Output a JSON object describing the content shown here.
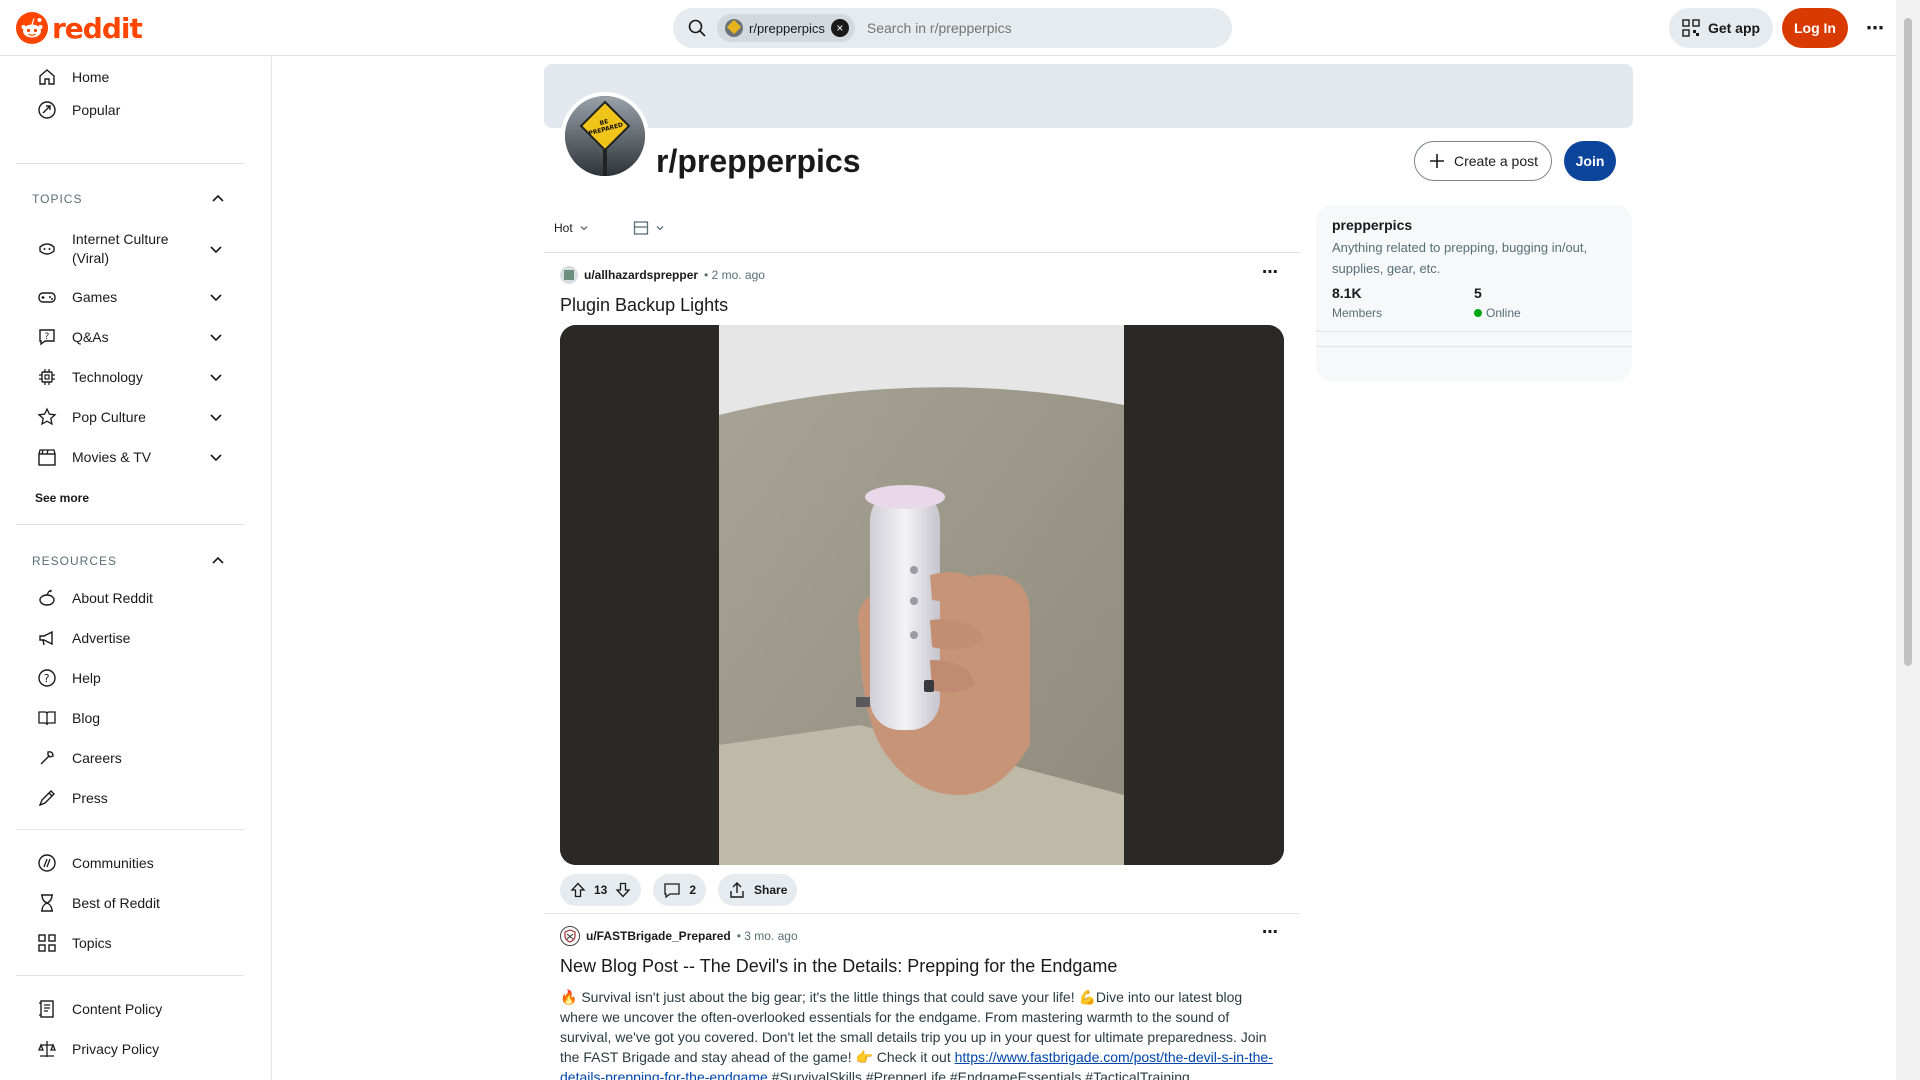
{
  "header": {
    "logo_text": "reddit",
    "search_chip": "r/prepperpics",
    "search_placeholder": "Search in r/prepperpics",
    "get_app": "Get app",
    "login": "Log In"
  },
  "sidebar": {
    "top_items": [
      {
        "label": "Home",
        "icon": "home-icon"
      },
      {
        "label": "Popular",
        "icon": "popular-icon"
      }
    ],
    "topics_title": "TOPICS",
    "topics": [
      {
        "label": "Internet Culture (Viral)",
        "line1": "Internet Culture",
        "line2": "(Viral)",
        "icon": "internet-culture-icon"
      },
      {
        "label": "Games",
        "icon": "games-icon"
      },
      {
        "label": "Q&As",
        "icon": "qa-icon"
      },
      {
        "label": "Technology",
        "icon": "technology-icon"
      },
      {
        "label": "Pop Culture",
        "icon": "pop-culture-icon"
      },
      {
        "label": "Movies & TV",
        "icon": "movies-tv-icon"
      }
    ],
    "see_more": "See more",
    "resources_title": "RESOURCES",
    "resources": [
      {
        "label": "About Reddit",
        "icon": "about-reddit-icon"
      },
      {
        "label": "Advertise",
        "icon": "advertise-icon"
      },
      {
        "label": "Help",
        "icon": "help-icon"
      },
      {
        "label": "Blog",
        "icon": "blog-icon"
      },
      {
        "label": "Careers",
        "icon": "careers-icon"
      },
      {
        "label": "Press",
        "icon": "press-icon"
      }
    ],
    "links": [
      {
        "label": "Communities",
        "icon": "communities-icon"
      },
      {
        "label": "Best of Reddit",
        "icon": "best-of-reddit-icon"
      },
      {
        "label": "Topics",
        "icon": "topics-icon"
      }
    ],
    "policies": [
      {
        "label": "Content Policy",
        "icon": "content-policy-icon"
      },
      {
        "label": "Privacy Policy",
        "icon": "privacy-policy-icon"
      }
    ]
  },
  "subreddit": {
    "title": "r/prepperpics",
    "avatar_sign": "BE PREPARED",
    "create_post": "Create a post",
    "join": "Join"
  },
  "sort": {
    "current": "Hot"
  },
  "posts": [
    {
      "user": "u/allhazardsprepper",
      "time": "• 2 mo. ago",
      "title": "Plugin Backup Lights",
      "upvotes": "13",
      "comments": "2",
      "share": "Share"
    },
    {
      "user": "u/FASTBrigade_Prepared",
      "time": "• 3 mo. ago",
      "title": "New Blog Post -- The Devil's in the Details: Prepping for the Endgame",
      "body_1": "🔥 Survival isn't just about the big gear; it's the little things that could save your life! 💪Dive into our latest blog where we uncover the often-overlooked essentials for the endgame. From mastering warmth to the sound of survival, we've got you covered. Don't let the small details trip you up in your quest for ultimate preparedness. Join the FAST Brigade and stay ahead of the game! 👉 Check it out ",
      "link": "https://www.fastbrigade.com/post/the-devil-s-in-the-details-prepping-for-the-endgame",
      "body_2": " #SurvivalSkills #PrepperLife #EndgameEssentials #TacticalTraining #FASTBrigade"
    }
  ],
  "about": {
    "name": "prepperpics",
    "description": "Anything related to prepping, bugging in/out, supplies, gear, etc.",
    "members_value": "8.1K",
    "members_label": "Members",
    "online_value": "5",
    "online_label": "Online",
    "online_color": "#01a816"
  },
  "colors": {
    "brand": "#ff4500",
    "login": "#d93a00",
    "join": "#0a449b"
  }
}
